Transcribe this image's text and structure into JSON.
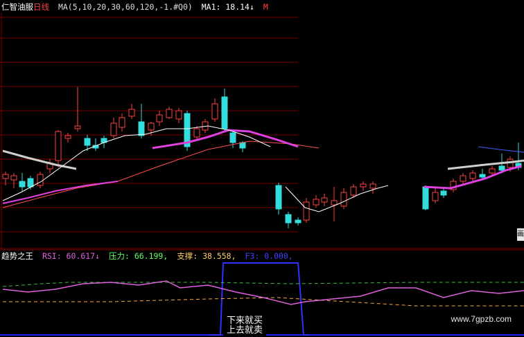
{
  "main_header": {
    "stock_name": "仁智油服",
    "period": "日线",
    "ma_params": "MA(5,10,20,30,60,120,-1.#Q0)",
    "ma1_label": "MA1: 18.14↓",
    "trailing": "M"
  },
  "sub_header": {
    "indicator_name": "趋势之王",
    "rsi_label": "RSI: 60.617↓",
    "pressure_label": "压力: 66.199,",
    "support_label": "支撑: 38.558,",
    "f3_label": "F3: 0.000,"
  },
  "labels": {
    "signal_line1": "下来就买",
    "signal_line2": "上去就卖",
    "watermark": "www.7gpzb.com",
    "side_tab": "画"
  },
  "colors": {
    "background": "#000000",
    "grid": "#7a0000",
    "candle_up": "#ff4040",
    "candle_down": "#33dddd",
    "ma_white": "#ffffff",
    "ma_magenta": "#e040e0",
    "ma_red": "#ff5050",
    "ma_gray": "#cfcfcf",
    "header_stock": "#ffffff",
    "header_period": "#ff4040",
    "header_ma": "#dddddd",
    "rsi_color": "#e060e0",
    "pressure_color": "#60ff60",
    "support_color": "#ffcc66",
    "f3_color": "#4040ff",
    "band_blue": "#3030ff",
    "dash_green": "#40c040",
    "dash_orange": "#ffaa40"
  }
}
